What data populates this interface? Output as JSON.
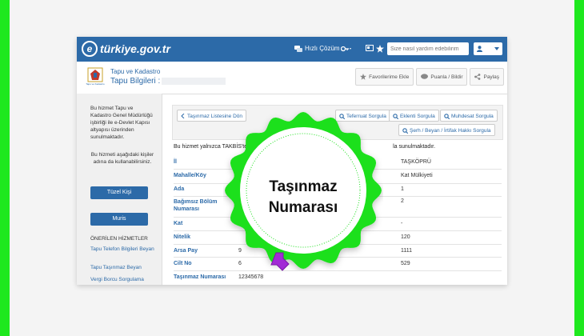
{
  "colors": {
    "frame": "#1ee81e",
    "brand": "#2c6aa8",
    "badge": "#1fe01f",
    "cursor": "#a22bd6"
  },
  "header": {
    "brand": "türkiye.gov.tr",
    "quick_solution": "Hızlı Çözüm",
    "search_placeholder": "Size nasıl yardım edebilirim",
    "icons": [
      "chat-icon",
      "key-icon",
      "card-icon",
      "star-icon",
      "user-icon",
      "caret-down-icon"
    ]
  },
  "service": {
    "org": "Tapu ve Kadastro",
    "logo_text": "Tapu ve Kadastro",
    "title": "Tapu Bilgileri :",
    "actions": [
      "Favorilerime Ekle",
      "Puanla / Bildir",
      "Paylaş"
    ]
  },
  "sidebar": {
    "intro": "Bu hizmet Tapu ve Kadastro Genel Müdürlüğü işbirliği ile e-Devlet Kapısı altyapısı üzerinden sunulmaktadır.",
    "persons_note": "Bu hizmeti aşağıdaki kişiler adına da kullanabilirsiniz.",
    "btn_legal": "Tüzel Kişi",
    "btn_muris": "Muris",
    "recommended_header": "ÖNERİLEN HİZMETLER",
    "links": [
      "Tapu Telefon Bilgileri Beyan",
      "Tapu Taşınmaz Beyan",
      "Vergi Borcu Sorgulama"
    ]
  },
  "main": {
    "back_button": "Taşınmaz Listesine Dön",
    "query_buttons": [
      "Teferruat Sorgula",
      "Eklenti Sorgula",
      "Muhdesat Sorgula",
      "Şerh / Beyan / İrtifak Hakkı Sorgula"
    ],
    "notice_left": "Bu hizmet yalnızca TAKBİS'te",
    "notice_right": "la sunulmaktadır.",
    "rows": [
      {
        "label": "İl",
        "value": "",
        "value2": "TAŞKÖPRÜ"
      },
      {
        "label": "Mahalle/Köy",
        "value": "",
        "value2": "Kat Mülkiyeti"
      },
      {
        "label": "Ada",
        "value": "",
        "value2": "1"
      },
      {
        "label": "Bağımsız Bölüm Numarası",
        "value": "",
        "value2": "2"
      },
      {
        "label": "Kat",
        "value": "",
        "value2": "-"
      },
      {
        "label": "Nitelik",
        "value": "",
        "value2": "120"
      },
      {
        "label": "Arsa Pay",
        "value": "9",
        "value2": "1111"
      },
      {
        "label": "Cilt No",
        "value": "6",
        "value2": "529"
      },
      {
        "label": "Taşınmaz Numarası",
        "value": "12345678",
        "value2": ""
      }
    ]
  },
  "badge": {
    "line1": "Taşınmaz",
    "line2": "Numarası"
  }
}
